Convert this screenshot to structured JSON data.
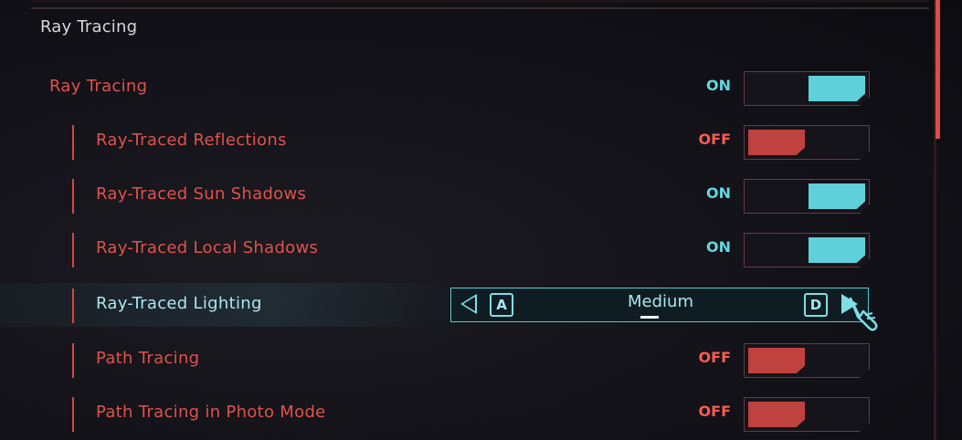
{
  "section": {
    "title": "Ray Tracing"
  },
  "settings": [
    {
      "label": "Ray Tracing",
      "state": "ON",
      "type": "toggle",
      "on": true,
      "indented": false
    },
    {
      "label": "Ray-Traced Reflections",
      "state": "OFF",
      "type": "toggle",
      "on": false,
      "indented": true
    },
    {
      "label": "Ray-Traced Sun Shadows",
      "state": "ON",
      "type": "toggle",
      "on": true,
      "indented": true
    },
    {
      "label": "Ray-Traced Local Shadows",
      "state": "ON",
      "type": "toggle",
      "on": true,
      "indented": true
    },
    {
      "label": "Ray-Traced Lighting",
      "type": "selector",
      "value": "Medium",
      "key_prev": "A",
      "key_next": "D",
      "indented": true,
      "highlighted": true
    },
    {
      "label": "Path Tracing",
      "state": "OFF",
      "type": "toggle",
      "on": false,
      "indented": true
    },
    {
      "label": "Path Tracing in Photo Mode",
      "state": "OFF",
      "type": "toggle",
      "on": false,
      "indented": true
    }
  ],
  "colors": {
    "accent_red": "#e0524c",
    "accent_cyan": "#5ed0da",
    "toggle_off": "#c0423f",
    "highlight_text": "#a9e6ef"
  },
  "icons": {
    "prev": "triangle-left-icon",
    "next": "triangle-right-icon",
    "cursor": "hand-pointer-icon"
  }
}
